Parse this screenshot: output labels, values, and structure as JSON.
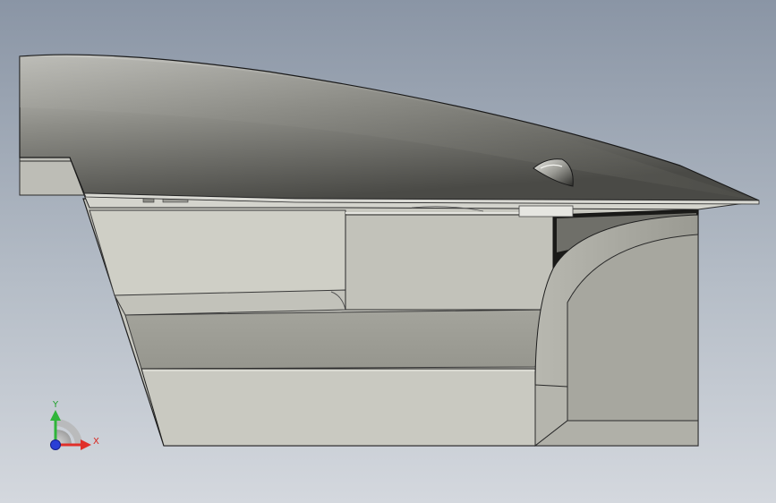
{
  "viewport": {
    "background_top": "#8a95a5",
    "background_bottom": "#d4d8de"
  },
  "triad": {
    "x_label": "X",
    "y_label": "Y",
    "x_color": "#e0302a",
    "y_color": "#2fb53a",
    "z_color": "#2a3fd6"
  },
  "model": {
    "icon": "cad-3d-part"
  }
}
